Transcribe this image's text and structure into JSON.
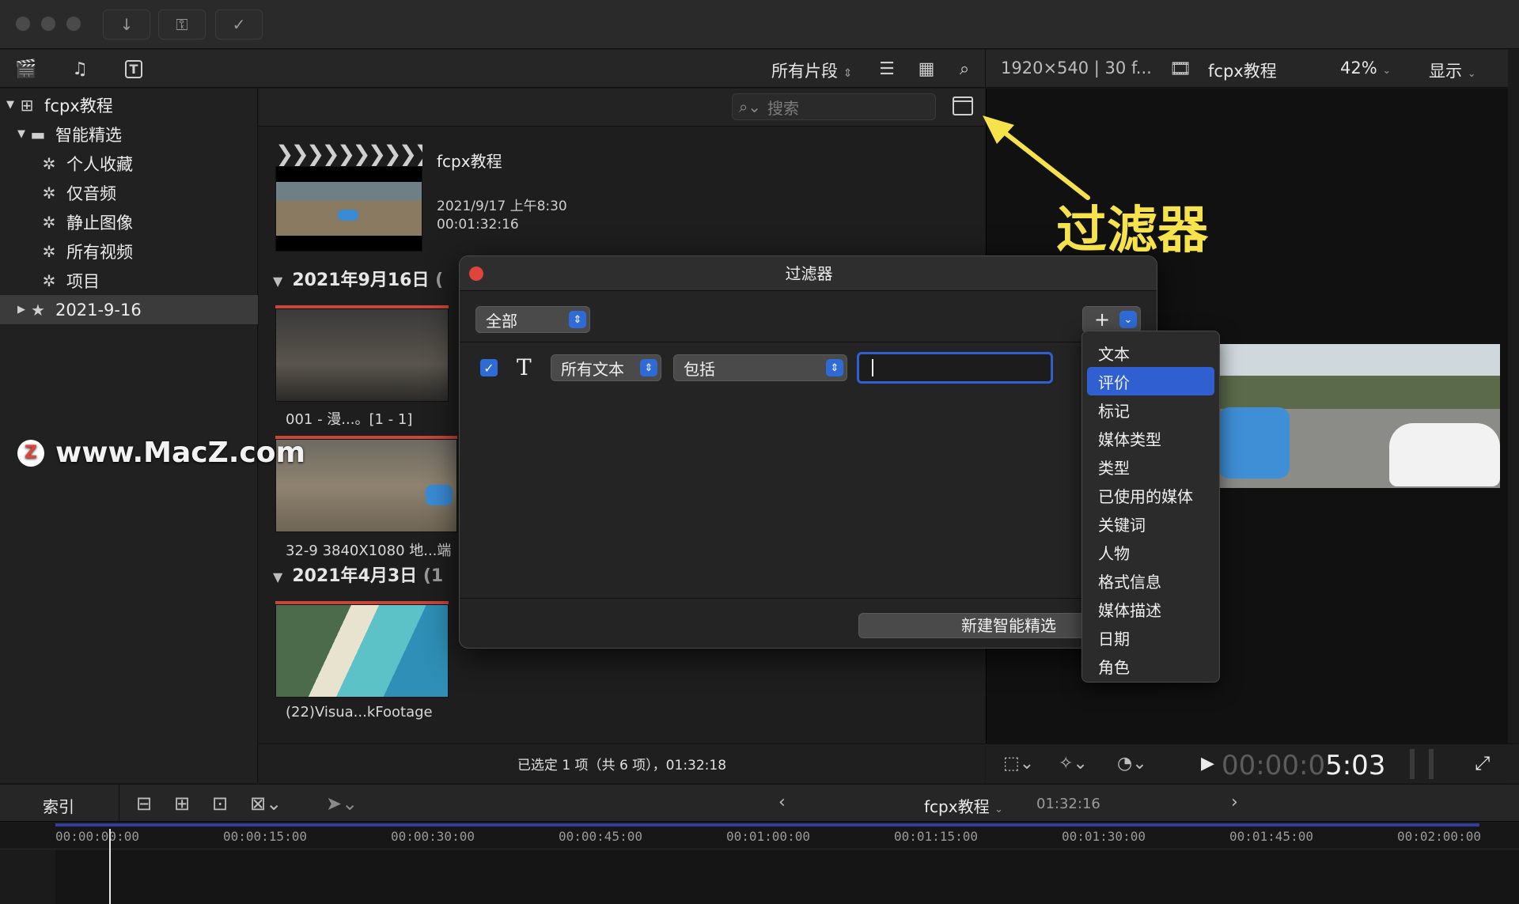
{
  "toolbar": {
    "clip_filter": "所有片段",
    "viewer_format": "1920×540 | 30 f...",
    "viewer_project": "fcpx教程",
    "zoom": "42%",
    "display_menu": "显示"
  },
  "sidebar": {
    "library": "fcpx教程",
    "smart_folder": "智能精选",
    "items": [
      "个人收藏",
      "仅音频",
      "静止图像",
      "所有视频",
      "项目"
    ],
    "event": "2021-9-16"
  },
  "search": {
    "placeholder": "搜索"
  },
  "browser": {
    "project_title": "fcpx教程",
    "project_date": "2021/9/17 上午8:30",
    "project_duration": "00:01:32:16",
    "group1_date": "2021年9月16日",
    "group1_count_trunc": "(",
    "clip1_label": "001 - 漫...。[1 - 1]",
    "clip2_label": "32-9 3840X1080 地...端",
    "group2_date": "2021年4月3日",
    "group2_count_trunc": "(1",
    "clip3_label": "(22)Visua...kFootage",
    "status": "已选定 1 项（共 6 项），01:32:18"
  },
  "dialog": {
    "title": "过滤器",
    "match_mode": "全部",
    "rule_field": "所有文本",
    "rule_operator": "包括",
    "new_smart_button": "新建智能精选"
  },
  "menu": {
    "items": [
      "文本",
      "评价",
      "标记",
      "媒体类型",
      "类型",
      "已使用的媒体",
      "关键词",
      "人物",
      "格式信息",
      "媒体描述",
      "日期",
      "角色"
    ],
    "highlighted_index": 1
  },
  "viewer": {
    "timecode_dim": "00:00:0",
    "timecode_bright": "5:03"
  },
  "timeline": {
    "index_tab": "索引",
    "project_name": "fcpx教程",
    "duration": "01:32:16",
    "ticks": [
      "00:00:00:00",
      "00:00:15:00",
      "00:00:30:00",
      "00:00:45:00",
      "00:01:00:00",
      "00:01:15:00",
      "00:01:30:00",
      "00:01:45:00",
      "00:02:00:00"
    ]
  },
  "annotations": {
    "callout": "过滤器",
    "watermark": "www.MacZ.com",
    "watermark_logo": "Z"
  },
  "colors": {
    "accent_blue": "#2f5fd0",
    "callout_yellow": "#f6e24a",
    "close_red": "#e0443a",
    "clip_redbar": "#c8463a"
  }
}
